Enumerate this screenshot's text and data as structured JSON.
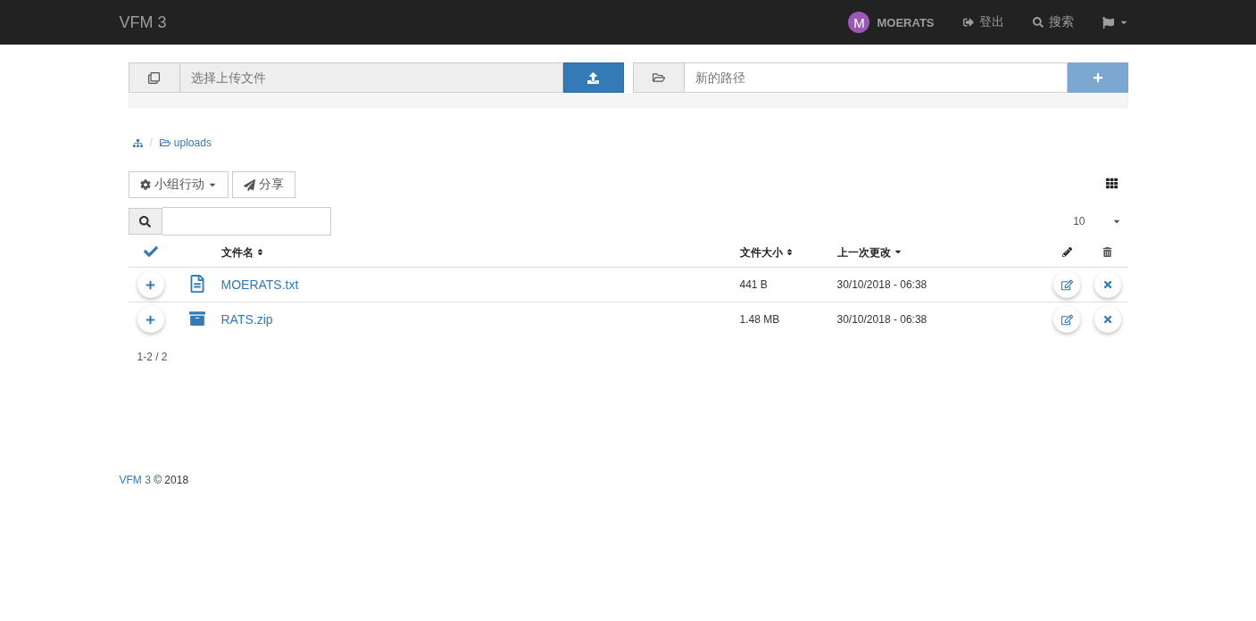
{
  "navbar": {
    "brand": "VFM 3",
    "user": {
      "initial": "M",
      "name": "MOERATS"
    },
    "links": [
      {
        "kind": "logout",
        "label": "登出"
      },
      {
        "kind": "search",
        "label": "搜索"
      }
    ]
  },
  "upload": {
    "placeholder": "选择上传文件",
    "level": 0
  },
  "new_folder": {
    "placeholder": "新的路径"
  },
  "breadcrumb": {
    "folder": "uploads",
    "separator": "/"
  },
  "toolbar": {
    "group_action": "小组行动",
    "share": "分享"
  },
  "per_page": "10",
  "table": {
    "columns": [
      {
        "label": "文件名",
        "kind": "sortable"
      },
      {
        "label": "文件大小",
        "kind": "sortable"
      },
      {
        "label": "上一次更改",
        "kind": "descending"
      }
    ],
    "rows": [
      {
        "kind": "text",
        "name": "MOERATS.txt",
        "size": "441 B",
        "modified": "30/10/2018 - 06:38"
      },
      {
        "kind": "archive",
        "name": "RATS.zip",
        "size": "1.48 MB",
        "modified": "30/10/2018 - 06:38"
      }
    ]
  },
  "pagination": "1-2 / 2",
  "footer": {
    "brand": "VFM 3",
    "copyright": "© 2018"
  }
}
